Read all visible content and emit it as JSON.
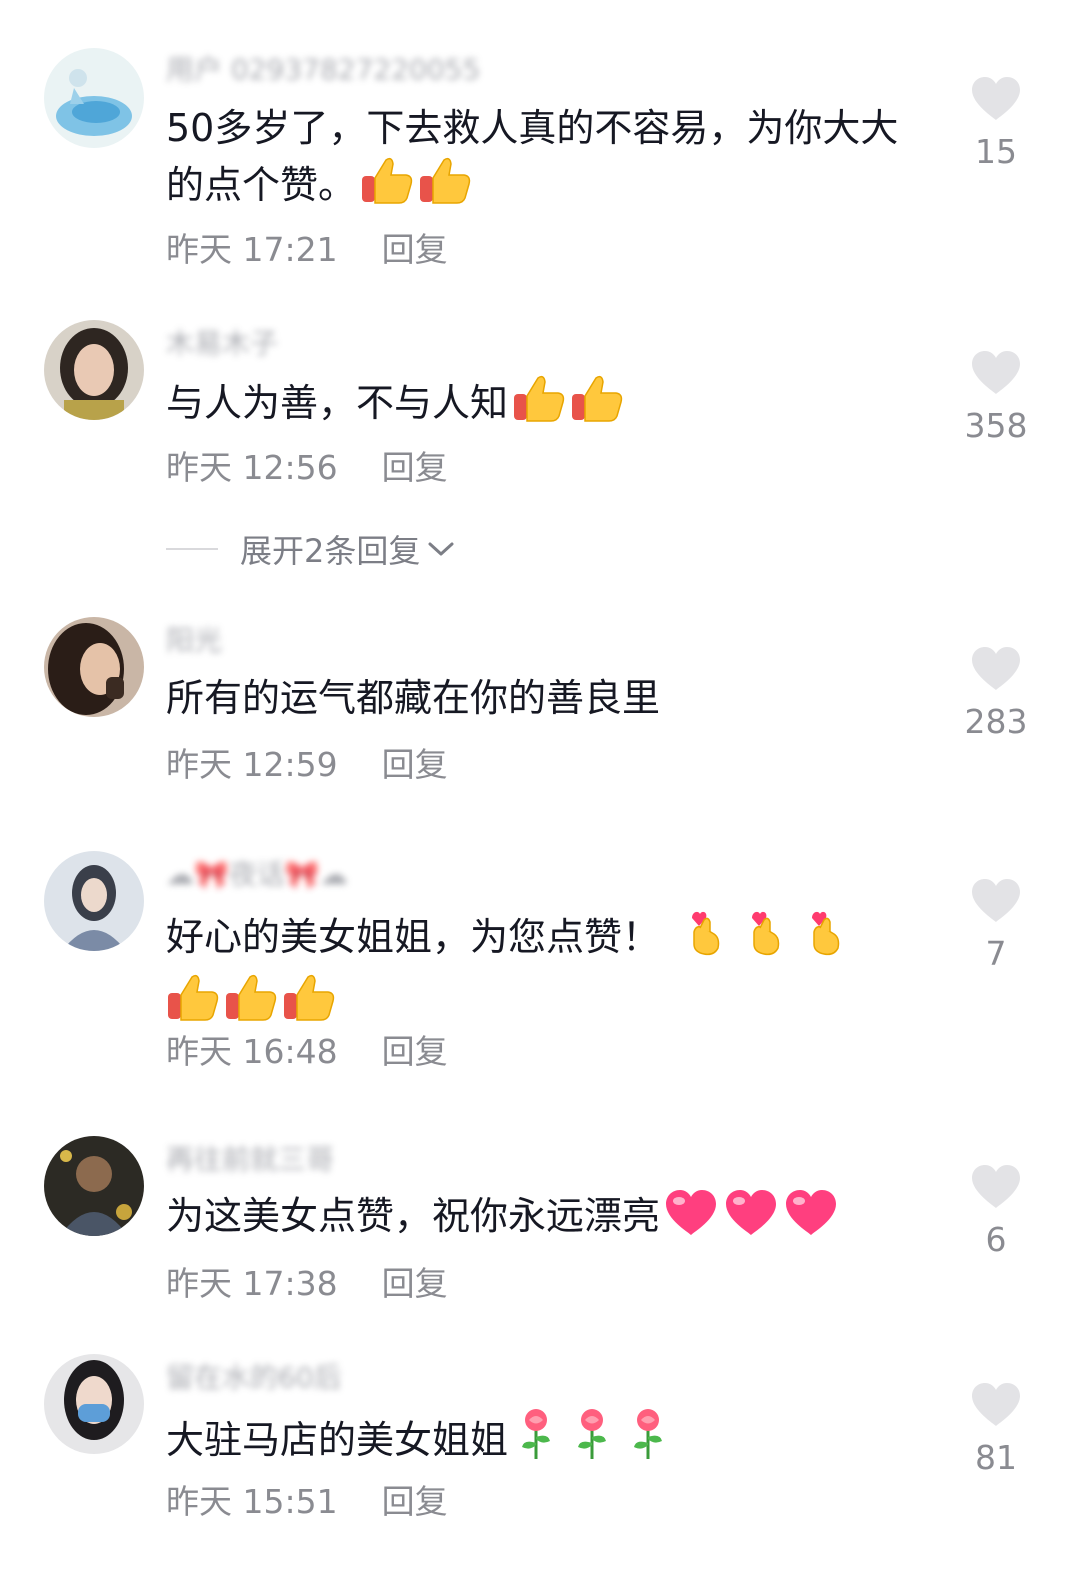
{
  "comments": [
    {
      "username": "用户 02937827220055",
      "text": "50多岁了，下去救人真的不容易，为你大大的点个赞。",
      "emojis": [
        "thumbs-up",
        "thumbs-up"
      ],
      "time": "昨天 17:21",
      "reply_label": "回复",
      "likes": "15"
    },
    {
      "username": "木易木子",
      "text": "与人为善，不与人知",
      "emojis": [
        "thumbs-up",
        "thumbs-up"
      ],
      "time": "昨天 12:56",
      "reply_label": "回复",
      "likes": "358"
    },
    {
      "username": "阳光",
      "text": "所有的运气都藏在你的善良里",
      "emojis": [],
      "time": "昨天 12:59",
      "reply_label": "回复",
      "likes": "283"
    },
    {
      "username": "☁🎀夜话🎀☁",
      "text": "好心的美女姐姐，为您点赞！",
      "emojis": [
        "finger-heart",
        "finger-heart",
        "finger-heart",
        "thumbs-up",
        "thumbs-up",
        "thumbs-up"
      ],
      "time": "昨天 16:48",
      "reply_label": "回复",
      "likes": "7"
    },
    {
      "username": "再往前就三哥",
      "text": "为这美女点赞，祝你永远漂亮",
      "emojis": [
        "heart",
        "heart",
        "heart"
      ],
      "time": "昨天 17:38",
      "reply_label": "回复",
      "likes": "6"
    },
    {
      "username": "留在水的60后",
      "text": "大驻马店的美女姐姐",
      "emojis": [
        "rose",
        "rose",
        "rose"
      ],
      "time": "昨天 15:51",
      "reply_label": "回复",
      "likes": "81"
    }
  ],
  "expand_replies": {
    "label": "展开2条回复"
  },
  "colors": {
    "text": "#161823",
    "meta": "#8a8b91",
    "heart_outline": "#e3e3e6"
  }
}
